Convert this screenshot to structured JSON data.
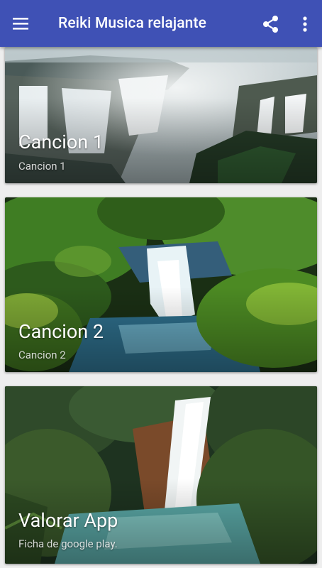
{
  "app_bar": {
    "title": "Reiki Musica relajante",
    "background": "#3f51b5",
    "icons": [
      "menu-icon",
      "share-icon",
      "more-vert-icon"
    ]
  },
  "cards": [
    {
      "title": "Cancion 1",
      "subtitle": "Cancion 1",
      "image": "waterfall-canyon"
    },
    {
      "title": "Cancion 2",
      "subtitle": "Cancion 2",
      "image": "waterfall-moss"
    },
    {
      "title": "Valorar App",
      "subtitle": "Ficha de google play.",
      "image": "waterfall-jungle"
    }
  ]
}
